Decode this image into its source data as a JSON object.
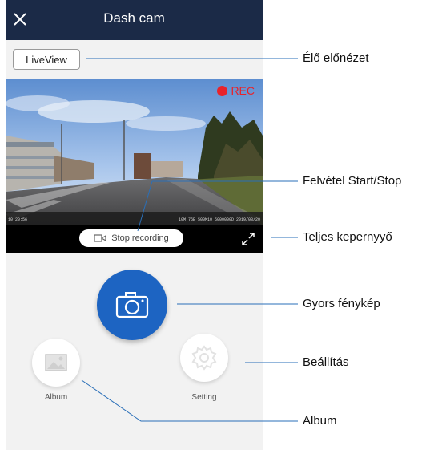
{
  "app": {
    "title": "Dash cam",
    "liveview_label": "LiveView",
    "rec_label": "REC",
    "stop_label": "Stop recording",
    "album_label": "Album",
    "setting_label": "Setting",
    "accent_color": "#1d64c2",
    "topbar_color": "#1b2a47",
    "rec_color": "#e8232b"
  },
  "video_overlay": {
    "left_stamp": "10:20:56",
    "right_stamp": "10M  76E  500M10  5000000D  2019/03/20"
  },
  "annotations": {
    "live_preview": "Élő előnézet",
    "record_start_stop": "Felvétel Start/Stop",
    "fullscreen": "Teljes kepernyyő",
    "quick_photo": "Gyors fénykép",
    "settings": "Beállítás",
    "album": "Album"
  },
  "icons": {
    "close": "close-icon",
    "record": "video-record-icon",
    "fullscreen": "fullscreen-icon",
    "camera": "camera-icon",
    "album": "image-icon",
    "setting": "gear-icon"
  }
}
